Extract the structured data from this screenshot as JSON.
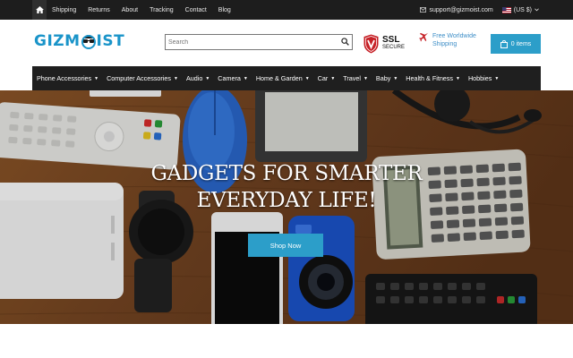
{
  "topbar": {
    "home_icon": "home-icon",
    "links": [
      "Shipping",
      "Returns",
      "About",
      "Tracking",
      "Contact",
      "Blog"
    ],
    "email": "support@gizmoist.com",
    "currency": "(US $)"
  },
  "header": {
    "logo_text": "GIZMOIST",
    "search_placeholder": "Search",
    "ssl_line1": "SSL",
    "ssl_line2": "SECURE",
    "shipping_line1": "Free Worldwide",
    "shipping_line2": "Shipping",
    "cart_label": "0 items"
  },
  "nav": {
    "items": [
      "Phone Accessories",
      "Computer Accessories",
      "Audio",
      "Camera",
      "Home & Garden",
      "Car",
      "Travel",
      "Baby",
      "Health & Fitness",
      "Hobbies"
    ]
  },
  "hero": {
    "line1": "GADGETS FOR SMARTER",
    "line2": "EVERYDAY LIFE!",
    "cta": "Shop Now"
  },
  "colors": {
    "accent": "#2c9ec9",
    "topbar": "#1d1d1d",
    "nav": "#1f1f1f",
    "ssl_red": "#c62026"
  }
}
